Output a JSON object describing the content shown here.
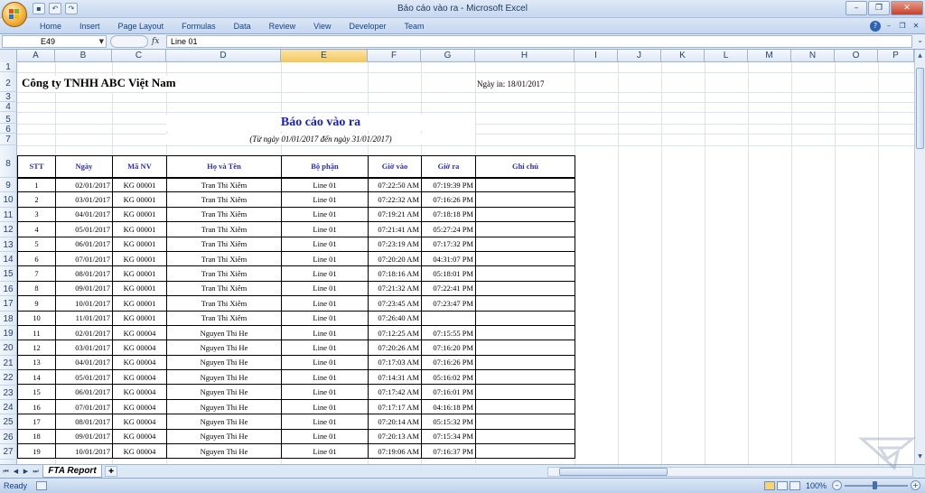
{
  "titlebar": {
    "title": "Báo cáo vào ra - Microsoft Excel",
    "qat_icons": [
      "save-icon",
      "undo-icon",
      "redo-icon"
    ],
    "window_buttons": [
      "minimize-icon",
      "restore-icon",
      "close-icon"
    ]
  },
  "ribbon": {
    "tabs": [
      "Home",
      "Insert",
      "Page Layout",
      "Formulas",
      "Data",
      "Review",
      "View",
      "Developer",
      "Team"
    ]
  },
  "formula_bar": {
    "name_box": "E49",
    "fx_label": "fx",
    "content": "Line 01"
  },
  "columns": [
    "A",
    "B",
    "C",
    "D",
    "E",
    "F",
    "G",
    "H",
    "I",
    "J",
    "K",
    "L",
    "M",
    "N",
    "O",
    "P"
  ],
  "selected_column": "E",
  "rows": [
    "1",
    "2",
    "3",
    "4",
    "5",
    "6",
    "7",
    "8",
    "9",
    "10",
    "11",
    "12",
    "13",
    "14",
    "15",
    "16",
    "17",
    "18",
    "19",
    "20",
    "21",
    "22",
    "23",
    "24",
    "25",
    "26",
    "27"
  ],
  "sheet": {
    "company": "Công ty TNHH ABC Việt Nam",
    "print_date": "Ngày in: 18/01/2017",
    "report_title": "Báo cáo vào ra",
    "report_subtitle": "(Từ ngày 01/01/2017 đến ngày 31/01/2017)",
    "headers": [
      "STT",
      "Ngày",
      "Mã NV",
      "Họ và Tên",
      "Bộ phận",
      "Giờ vào",
      "Giờ ra",
      "Ghi chú"
    ],
    "records": [
      [
        "1",
        "02/01/2017",
        "KG 00001",
        "Tran Thi Xiêm",
        "Line 01",
        "07:22:50 AM",
        "07:19:39 PM",
        ""
      ],
      [
        "2",
        "03/01/2017",
        "KG 00001",
        "Tran Thi Xiêm",
        "Line 01",
        "07:22:32 AM",
        "07:16:26 PM",
        ""
      ],
      [
        "3",
        "04/01/2017",
        "KG 00001",
        "Tran Thi Xiêm",
        "Line 01",
        "07:19:21 AM",
        "07:18:18 PM",
        ""
      ],
      [
        "4",
        "05/01/2017",
        "KG 00001",
        "Tran Thi Xiêm",
        "Line 01",
        "07:21:41 AM",
        "05:27:24 PM",
        ""
      ],
      [
        "5",
        "06/01/2017",
        "KG 00001",
        "Tran Thi Xiêm",
        "Line 01",
        "07:23:19 AM",
        "07:17:32 PM",
        ""
      ],
      [
        "6",
        "07/01/2017",
        "KG 00001",
        "Tran Thi Xiêm",
        "Line 01",
        "07:20:20 AM",
        "04:31:07 PM",
        ""
      ],
      [
        "7",
        "08/01/2017",
        "KG 00001",
        "Tran Thi Xiêm",
        "Line 01",
        "07:18:16 AM",
        "05:18:01 PM",
        ""
      ],
      [
        "8",
        "09/01/2017",
        "KG 00001",
        "Tran Thi Xiêm",
        "Line 01",
        "07:21:32 AM",
        "07:22:41 PM",
        ""
      ],
      [
        "9",
        "10/01/2017",
        "KG 00001",
        "Tran Thi Xiêm",
        "Line 01",
        "07:23:45 AM",
        "07:23:47 PM",
        ""
      ],
      [
        "10",
        "11/01/2017",
        "KG 00001",
        "Tran Thi Xiêm",
        "Line 01",
        "07:26:40 AM",
        "",
        ""
      ],
      [
        "11",
        "02/01/2017",
        "KG 00004",
        "Nguyen Thi He",
        "Line 01",
        "07:12:25 AM",
        "07:15:55 PM",
        ""
      ],
      [
        "12",
        "03/01/2017",
        "KG 00004",
        "Nguyen Thi He",
        "Line 01",
        "07:20:26 AM",
        "07:16:20 PM",
        ""
      ],
      [
        "13",
        "04/01/2017",
        "KG 00004",
        "Nguyen Thi He",
        "Line 01",
        "07:17:03 AM",
        "07:16:26 PM",
        ""
      ],
      [
        "14",
        "05/01/2017",
        "KG 00004",
        "Nguyen Thi He",
        "Line 01",
        "07:14:31 AM",
        "05:16:02 PM",
        ""
      ],
      [
        "15",
        "06/01/2017",
        "KG 00004",
        "Nguyen Thi He",
        "Line 01",
        "07:17:42 AM",
        "07:16:01 PM",
        ""
      ],
      [
        "16",
        "07/01/2017",
        "KG 00004",
        "Nguyen Thi He",
        "Line 01",
        "07:17:17 AM",
        "04:16:18 PM",
        ""
      ],
      [
        "17",
        "08/01/2017",
        "KG 00004",
        "Nguyen Thi He",
        "Line 01",
        "07:20:14 AM",
        "05:15:32 PM",
        ""
      ],
      [
        "18",
        "09/01/2017",
        "KG 00004",
        "Nguyen Thi He",
        "Line 01",
        "07:20:13 AM",
        "07:15:34 PM",
        ""
      ],
      [
        "19",
        "10/01/2017",
        "KG 00004",
        "Nguyen Thi He",
        "Line 01",
        "07:19:06 AM",
        "07:16:37 PM",
        ""
      ]
    ]
  },
  "sheet_tabs": [
    "FTA Report"
  ],
  "statusbar": {
    "status": "Ready",
    "zoom": "100%"
  },
  "colors": {
    "header_blue": "#2b2bbf",
    "title_blue": "#1a1fbf",
    "selected_header": "#f4c65e"
  }
}
